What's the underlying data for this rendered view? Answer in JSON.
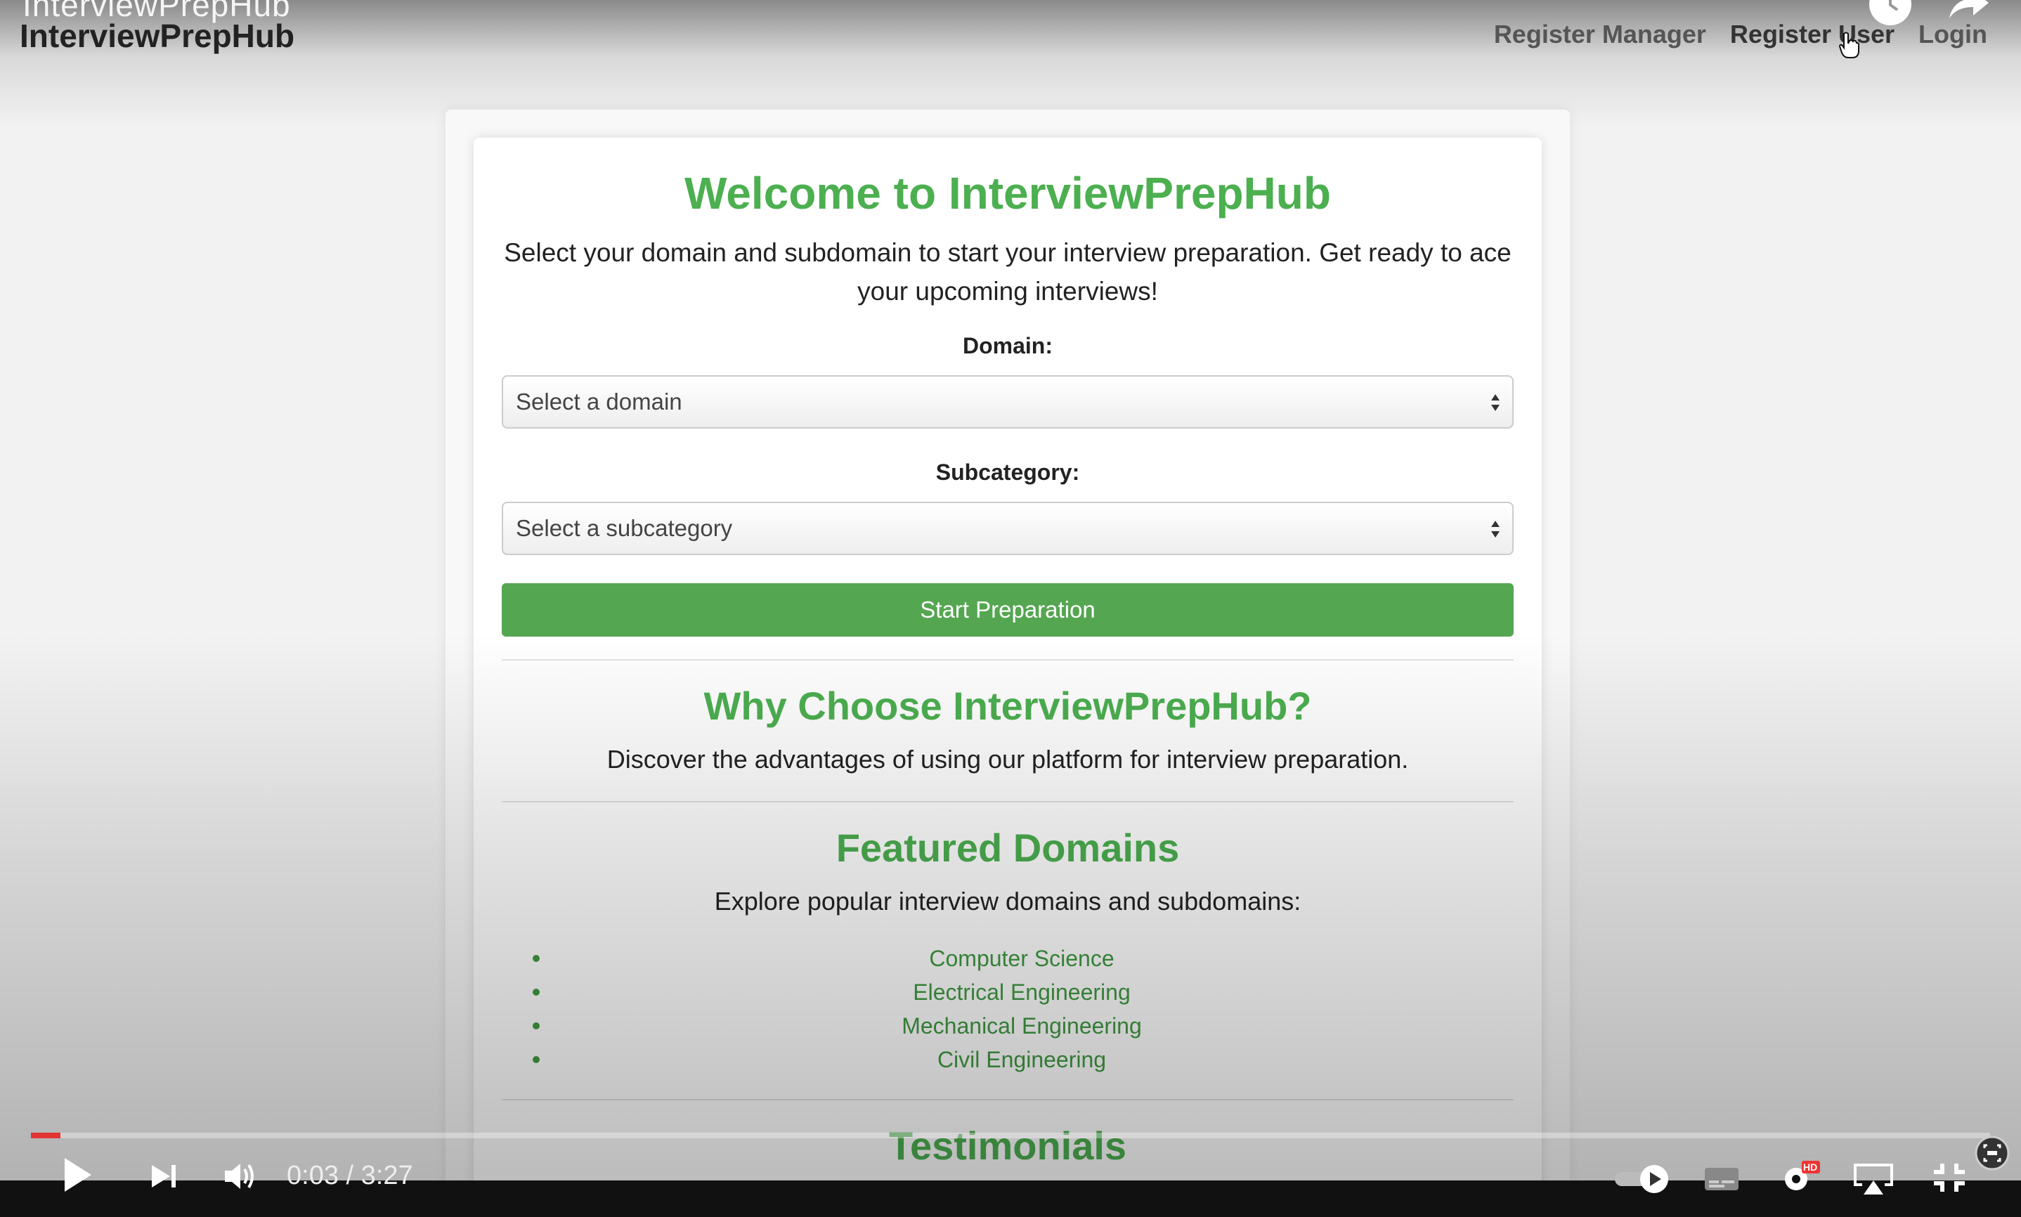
{
  "header": {
    "ghost_title": "InterviewPrepHub",
    "brand": "InterviewPrepHub",
    "nav": [
      {
        "label": "Register Manager"
      },
      {
        "label": "Register User"
      },
      {
        "label": "Login"
      }
    ]
  },
  "hero": {
    "title": "Welcome to InterviewPrepHub",
    "intro": "Select your domain and subdomain to start your interview preparation. Get ready to ace your upcoming interviews!"
  },
  "form": {
    "domain_label": "Domain:",
    "domain_value": "Select a domain",
    "subcategory_label": "Subcategory:",
    "subcategory_value": "Select a subcategory",
    "submit_label": "Start Preparation"
  },
  "why": {
    "title": "Why Choose InterviewPrepHub?",
    "text": "Discover the advantages of using our platform for interview preparation."
  },
  "featured": {
    "title": "Featured Domains",
    "text": "Explore popular interview domains and subdomains:",
    "items": [
      "Computer Science",
      "Electrical Engineering",
      "Mechanical Engineering",
      "Civil Engineering"
    ]
  },
  "testimonials": {
    "title": "Testimonials"
  },
  "player": {
    "time": "0:03 / 3:27",
    "progress_fraction": 0.015,
    "icons": [
      "play-icon",
      "next-icon",
      "volume-icon",
      "autoplay-toggle-icon",
      "captions-icon",
      "settings-icon",
      "hd-badge-icon",
      "airplay-icon",
      "exit-fullscreen-icon"
    ],
    "hd_badge": "HD",
    "accent": "#e33333"
  },
  "colors": {
    "brand_green": "#4caf50",
    "button_green": "#55a651",
    "link_green": "#3f9a41"
  }
}
